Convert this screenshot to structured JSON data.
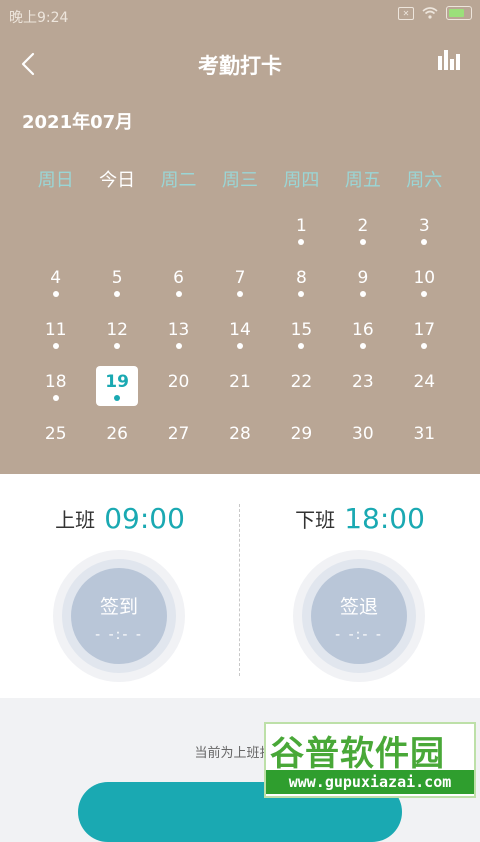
{
  "status_bar": {
    "time": "晚上9:24"
  },
  "header": {
    "title": "考勤打卡",
    "month": "2021年07月"
  },
  "calendar": {
    "weekdays": [
      "周日",
      "今日",
      "周二",
      "周三",
      "周四",
      "周五",
      "周六"
    ],
    "days": [
      {
        "label": "",
        "dot": false
      },
      {
        "label": "",
        "dot": false
      },
      {
        "label": "",
        "dot": false
      },
      {
        "label": "",
        "dot": false
      },
      {
        "label": "1",
        "dot": true
      },
      {
        "label": "2",
        "dot": true
      },
      {
        "label": "3",
        "dot": true
      },
      {
        "label": "4",
        "dot": true
      },
      {
        "label": "5",
        "dot": true
      },
      {
        "label": "6",
        "dot": true
      },
      {
        "label": "7",
        "dot": true
      },
      {
        "label": "8",
        "dot": true
      },
      {
        "label": "9",
        "dot": true
      },
      {
        "label": "10",
        "dot": true
      },
      {
        "label": "11",
        "dot": true
      },
      {
        "label": "12",
        "dot": true
      },
      {
        "label": "13",
        "dot": true
      },
      {
        "label": "14",
        "dot": true
      },
      {
        "label": "15",
        "dot": true
      },
      {
        "label": "16",
        "dot": true
      },
      {
        "label": "17",
        "dot": true
      },
      {
        "label": "18",
        "dot": true
      },
      {
        "label": "19",
        "dot": true,
        "selected": true
      },
      {
        "label": "20",
        "dot": false
      },
      {
        "label": "21",
        "dot": false
      },
      {
        "label": "22",
        "dot": false
      },
      {
        "label": "23",
        "dot": false
      },
      {
        "label": "24",
        "dot": false
      },
      {
        "label": "25",
        "dot": false
      },
      {
        "label": "26",
        "dot": false
      },
      {
        "label": "27",
        "dot": false
      },
      {
        "label": "28",
        "dot": false
      },
      {
        "label": "29",
        "dot": false
      },
      {
        "label": "30",
        "dot": false
      },
      {
        "label": "31",
        "dot": false
      }
    ]
  },
  "punch": {
    "on": {
      "label": "上班",
      "time": "09:00",
      "action": "签到",
      "placeholder": "- -:- -"
    },
    "off": {
      "label": "下班",
      "time": "18:00",
      "action": "签退",
      "placeholder": "- -:- -"
    }
  },
  "footer": {
    "hint": "当前为上班打卡"
  },
  "watermark": {
    "logo": "谷普软件园",
    "url": "www.gupuxiazai.com"
  },
  "colors": {
    "header_bg": "#b9a695",
    "accent": "#1aa9b2",
    "circle": "#b9c6d8"
  },
  "icons": {
    "back": "back-arrow-icon",
    "stats": "bar-chart-icon"
  }
}
